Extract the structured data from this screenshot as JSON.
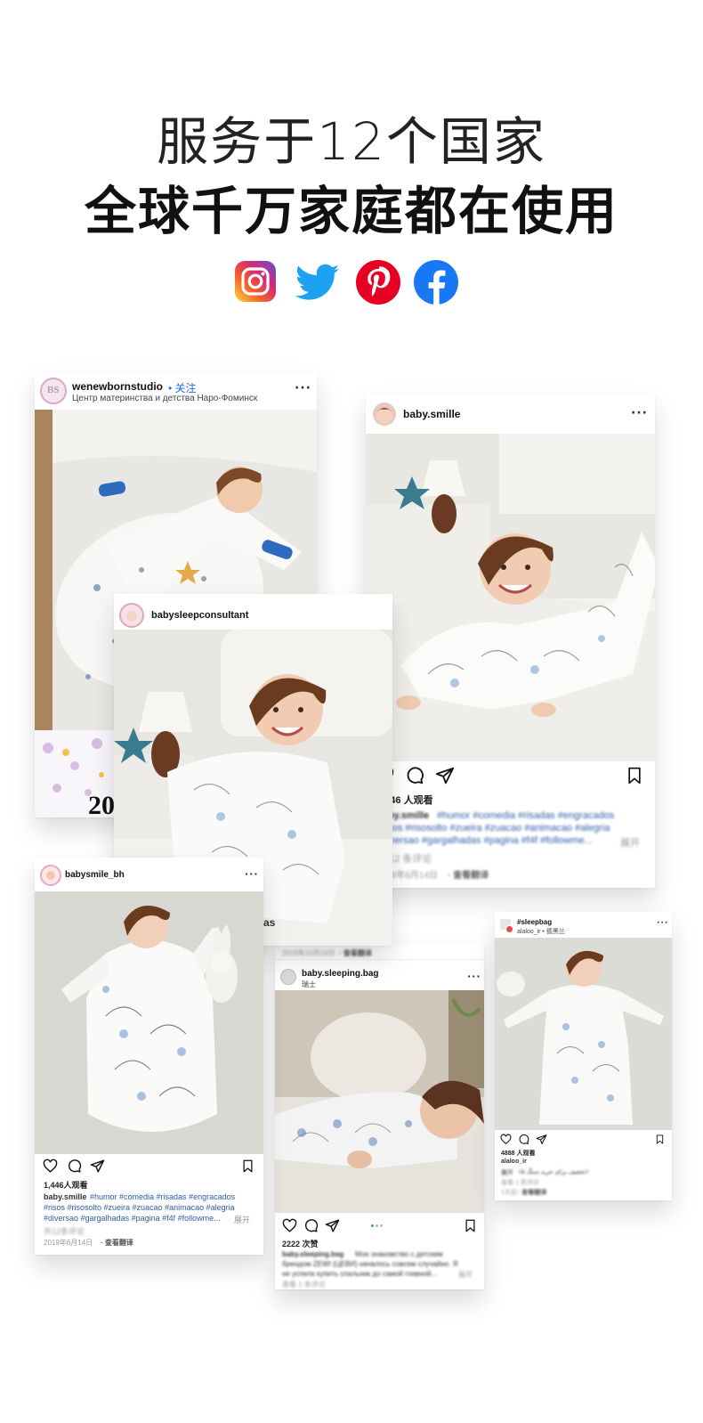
{
  "header": {
    "line1": "服务于12个国家",
    "line2": "全球千万家庭都在使用"
  },
  "social_icons": [
    "instagram-icon",
    "twitter-icon",
    "pinterest-icon",
    "facebook-icon"
  ],
  "colors": {
    "twitter": "#1da1f2",
    "pinterest": "#e60023",
    "facebook": "#1877f2",
    "link": "#2d5da8",
    "follow": "#1b6fe0"
  },
  "cards": {
    "wenewborn": {
      "username": "wenewbornstudio",
      "follow": "• 关注",
      "subtitle": "Центр материнства и детства Наро-Фоминск",
      "avatar_text": "BS",
      "partial_text": "20"
    },
    "consultant": {
      "username": "babysleepconsultant"
    },
    "smille": {
      "username": "baby.smille",
      "views": "1,446 人观看",
      "caption_user": "baby.smille",
      "caption_tags_1": "#humor #comedia #risadas #engracados",
      "caption_tags_2": "#risos #risosolto #zueira #zuacao #animacao #alegria",
      "caption_tags_3": "#diversao #gargalhadas #pagina #f4f #followme...",
      "more": "展开",
      "comments": "共 12 条评论",
      "date": "2019年6月14日",
      "translate": "· 查看翻译"
    },
    "babysmile_bh": {
      "username": "babysmile_bh",
      "views": "1,446人观看",
      "caption_user": "baby.smille",
      "caption_tags_1": "#humor #comedia #risadas #engracados",
      "caption_tags_2": "#risos #risosolto #zueira #zuacao #animacao #alegria",
      "caption_tags_3": "#diversao #gargalhadas #pagina #f4f #followme...",
      "more": "展开",
      "comments": "共12条评论",
      "date": "2019年6月14日",
      "translate": "· 查看翻译"
    },
    "sleeping_bag": {
      "top_date": "2018年10月19日",
      "top_translate": "· 查看翻译",
      "username": "baby.sleeping.bag",
      "location": "瑞士",
      "likes": "2222 次赞",
      "caption_user": "baby.sleeping.bag",
      "caption_1": "Мое знакомство с детским",
      "caption_2": "брендом ZEWI (ЦЕВИ) началось совсем случайно. Я",
      "caption_3": "не успела купить спальник до самой главной...",
      "caption_more": "展开",
      "comments": "查看 1 条评论",
      "partial_text": "as"
    },
    "sleepbag": {
      "username": "#sleepbag",
      "subtitle": "alaloo_ir • 德黑兰",
      "likes": "4888 人观看",
      "caption_user": "alaloo_ir",
      "caption_text": "تخفیف برای خرید سنگ ۱۵٪",
      "caption_more": "展开",
      "comments": "查看 1 条评论",
      "date": "1天前",
      "translate": "· 查看翻译"
    }
  }
}
